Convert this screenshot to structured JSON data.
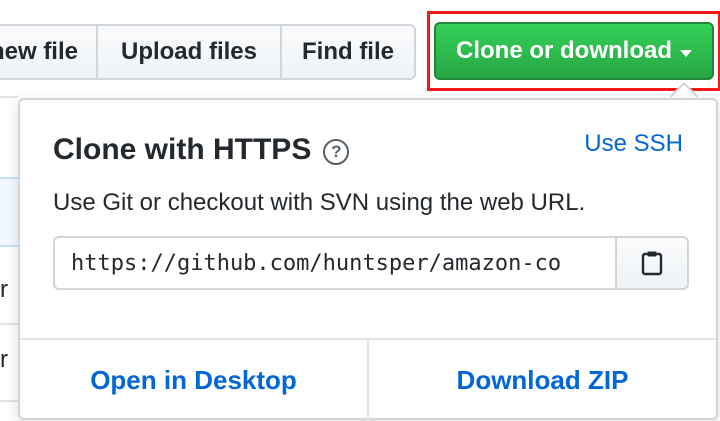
{
  "toolbar": {
    "new_file_label": "Create new file",
    "upload_files_label": "Upload files",
    "find_file_label": "Find file",
    "clone_label": "Clone or download"
  },
  "popover": {
    "title": "Clone with HTTPS",
    "help_symbol": "?",
    "use_ssh_label": "Use SSH",
    "description": "Use Git or checkout with SVN using the web URL.",
    "url_value": "https://github.com/huntsper/amazon-co",
    "open_desktop_label": "Open in Desktop",
    "download_zip_label": "Download ZIP"
  },
  "background": {
    "row_char_1": "r",
    "row_char_2": "r"
  },
  "icons": {
    "help": "question-circle-icon",
    "copy": "clipboard-icon",
    "dropdown": "caret-down-icon"
  },
  "colors": {
    "clone_green": "#2ea44f",
    "link_blue": "#0366d6",
    "highlight_red": "#f21a1a"
  }
}
